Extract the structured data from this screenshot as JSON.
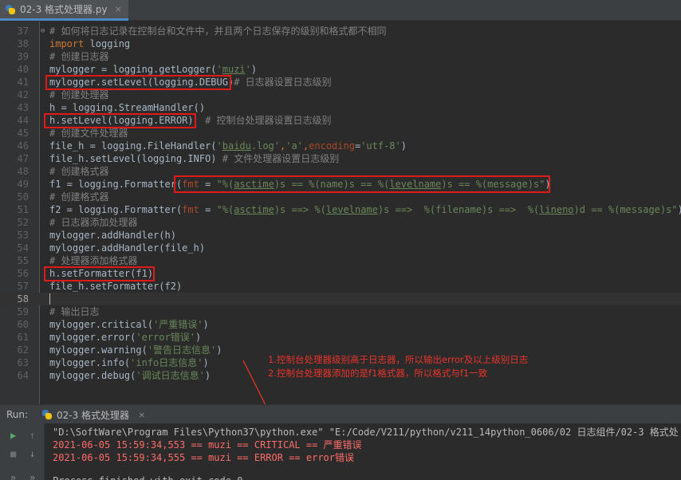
{
  "tab": {
    "title": "02-3 格式处理器.py",
    "close": "×"
  },
  "editor": {
    "lines": [
      {
        "n": "37",
        "segs": [
          {
            "t": "# 如何将日志记录在控制台和文件中，并且两个日志保存的级别和格式都不相同",
            "c": "cm"
          }
        ]
      },
      {
        "n": "38",
        "segs": [
          {
            "t": "import",
            "c": "kw"
          },
          {
            "t": " logging",
            "c": ""
          }
        ]
      },
      {
        "n": "39",
        "segs": [
          {
            "t": "# 创建日志器",
            "c": "cm"
          }
        ]
      },
      {
        "n": "40",
        "segs": [
          {
            "t": "mylogger = logging.getLogger(",
            "c": ""
          },
          {
            "t": "'",
            "c": "st"
          },
          {
            "t": "muzi",
            "c": "st ul"
          },
          {
            "t": "'",
            "c": "st"
          },
          {
            "t": ")",
            "c": ""
          }
        ]
      },
      {
        "n": "41",
        "segs": [
          {
            "t": "mylogger.setLevel(logging.DEBUG)",
            "c": ""
          },
          {
            "t": "# 日志器设置日志级别",
            "c": "cm"
          }
        ]
      },
      {
        "n": "42",
        "segs": [
          {
            "t": "# 创建处理器",
            "c": "cm"
          }
        ]
      },
      {
        "n": "43",
        "segs": [
          {
            "t": "h = logging.StreamHandler()",
            "c": ""
          }
        ]
      },
      {
        "n": "44",
        "segs": [
          {
            "t": "h.setLevel(logging.ERROR)  ",
            "c": ""
          },
          {
            "t": "# 控制台处理器设置日志级别",
            "c": "cm"
          }
        ]
      },
      {
        "n": "45",
        "segs": [
          {
            "t": "# 创建文件处理器",
            "c": "cm"
          }
        ]
      },
      {
        "n": "46",
        "segs": [
          {
            "t": "file_h = logging.FileHandler(",
            "c": ""
          },
          {
            "t": "'",
            "c": "st"
          },
          {
            "t": "baidu",
            "c": "st ul"
          },
          {
            "t": ".log'",
            "c": "st"
          },
          {
            "t": ",",
            "c": "kw"
          },
          {
            "t": "'a'",
            "c": "st"
          },
          {
            "t": ",",
            "c": "kw"
          },
          {
            "t": "encoding",
            "c": "pm"
          },
          {
            "t": "=",
            "c": ""
          },
          {
            "t": "'utf-8'",
            "c": "st"
          },
          {
            "t": ")",
            "c": ""
          }
        ]
      },
      {
        "n": "47",
        "segs": [
          {
            "t": "file_h.setLevel(logging.INFO) ",
            "c": ""
          },
          {
            "t": "# 文件处理器设置日志级别",
            "c": "cm"
          }
        ]
      },
      {
        "n": "48",
        "segs": [
          {
            "t": "# 创建格式器",
            "c": "cm"
          }
        ]
      },
      {
        "n": "49",
        "segs": [
          {
            "t": "f1 = logging.Formatter(",
            "c": ""
          },
          {
            "t": "fmt",
            "c": "pm"
          },
          {
            "t": " = ",
            "c": ""
          },
          {
            "t": "\"%(",
            "c": "st"
          },
          {
            "t": "asctime",
            "c": "st ul"
          },
          {
            "t": ")s == %(name)s == %(",
            "c": "st"
          },
          {
            "t": "levelname",
            "c": "st ul"
          },
          {
            "t": ")s == %(message)s\"",
            "c": "st"
          },
          {
            "t": ")",
            "c": ""
          }
        ]
      },
      {
        "n": "50",
        "segs": [
          {
            "t": "# 创建格式器",
            "c": "cm"
          }
        ]
      },
      {
        "n": "51",
        "segs": [
          {
            "t": "f2 = logging.Formatter(",
            "c": ""
          },
          {
            "t": "fmt",
            "c": "pm"
          },
          {
            "t": " = ",
            "c": ""
          },
          {
            "t": "\"%(",
            "c": "st"
          },
          {
            "t": "asctime",
            "c": "st ul"
          },
          {
            "t": ")s ==> %(",
            "c": "st"
          },
          {
            "t": "levelname",
            "c": "st ul"
          },
          {
            "t": ")s ==>  %(filename)s ==>  %(",
            "c": "st"
          },
          {
            "t": "lineno",
            "c": "st ul"
          },
          {
            "t": ")d == %(message)s\"",
            "c": "st"
          },
          {
            "t": ")",
            "c": ""
          }
        ]
      },
      {
        "n": "52",
        "segs": [
          {
            "t": "# 日志器添加处理器",
            "c": "cm"
          }
        ]
      },
      {
        "n": "53",
        "segs": [
          {
            "t": "mylogger.addHandler(h)",
            "c": ""
          }
        ]
      },
      {
        "n": "54",
        "segs": [
          {
            "t": "mylogger.addHandler(file_h)",
            "c": ""
          }
        ]
      },
      {
        "n": "55",
        "segs": [
          {
            "t": "# 处理器添加格式器",
            "c": "cm"
          }
        ]
      },
      {
        "n": "56",
        "segs": [
          {
            "t": "h.setFormatter(f1)",
            "c": ""
          }
        ]
      },
      {
        "n": "57",
        "segs": [
          {
            "t": "file_h.setFormatter(f2)",
            "c": ""
          }
        ]
      },
      {
        "n": "58",
        "segs": [],
        "current": true
      },
      {
        "n": "59",
        "segs": [
          {
            "t": "# 输出日志",
            "c": "cm"
          }
        ]
      },
      {
        "n": "60",
        "segs": [
          {
            "t": "mylogger.critical(",
            "c": ""
          },
          {
            "t": "'严重错误'",
            "c": "st"
          },
          {
            "t": ")",
            "c": ""
          }
        ]
      },
      {
        "n": "61",
        "segs": [
          {
            "t": "mylogger.error(",
            "c": ""
          },
          {
            "t": "'error错误'",
            "c": "st"
          },
          {
            "t": ")",
            "c": ""
          }
        ]
      },
      {
        "n": "62",
        "segs": [
          {
            "t": "mylogger.warning(",
            "c": ""
          },
          {
            "t": "'警告日志信息'",
            "c": "st"
          },
          {
            "t": ")",
            "c": ""
          }
        ]
      },
      {
        "n": "63",
        "segs": [
          {
            "t": "mylogger.info(",
            "c": ""
          },
          {
            "t": "'info日志信息'",
            "c": "st"
          },
          {
            "t": ")",
            "c": ""
          }
        ]
      },
      {
        "n": "64",
        "segs": [
          {
            "t": "mylogger.debug(",
            "c": ""
          },
          {
            "t": "'调试日志信息'",
            "c": "st"
          },
          {
            "t": ")",
            "c": ""
          }
        ]
      }
    ]
  },
  "annotation": {
    "line1": "1.控制台处理器级别高于日志器，所以输出error及以上级别日志",
    "line2": "2.控制台处理器添加的是f1格式器，所以格式与f1一致"
  },
  "run": {
    "label": "Run:",
    "tab_title": "02-3 格式处理器",
    "close": "×",
    "output": [
      {
        "t": "\"D:\\SoftWare\\Program Files\\Python37\\python.exe\" \"E:/Code/V211/python/v211_14python_0606/02 日志组件/02-3 格式处",
        "c": "cmd"
      },
      {
        "t": "2021-06-05 15:59:34,553 == muzi == CRITICAL == 严重错误",
        "c": "err"
      },
      {
        "t": "2021-06-05 15:59:34,555 == muzi == ERROR == error错误",
        "c": "err"
      },
      {
        "t": "Process finished with exit code 0",
        "c": "cmd"
      }
    ]
  },
  "colors": {
    "background": "#2b2b2b",
    "comment": "#808080",
    "keyword": "#cc7832",
    "string": "#6a8759",
    "param": "#aa4926",
    "highlight_box": "#e01919",
    "annotation": "#e8332b",
    "error_output": "#ff6b68"
  },
  "icons": [
    "python-file-icon",
    "run-play-icon",
    "stop-icon",
    "arrow-up-icon",
    "arrow-down-icon",
    "pin-icon",
    "fold-marker-icon"
  ]
}
